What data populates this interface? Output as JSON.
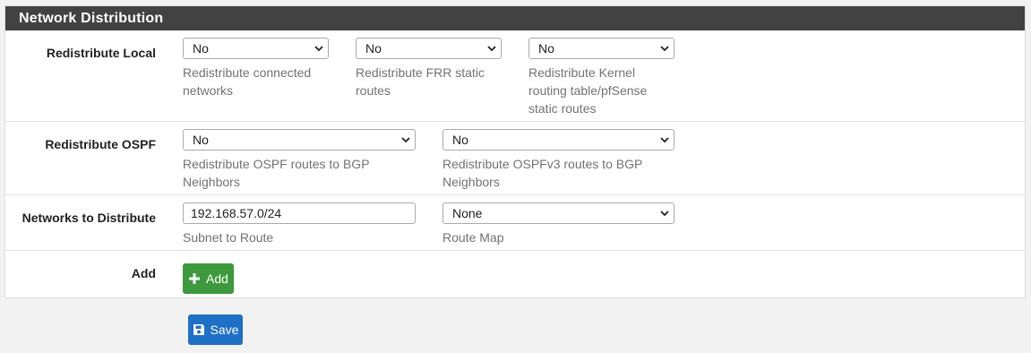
{
  "panel": {
    "title": "Network Distribution"
  },
  "redistribute_local": {
    "label": "Redistribute Local",
    "fields": [
      {
        "value": "No",
        "help": "Redistribute connected networks"
      },
      {
        "value": "No",
        "help": "Redistribute FRR static routes"
      },
      {
        "value": "No",
        "help": "Redistribute Kernel routing table/pfSense static routes"
      }
    ]
  },
  "redistribute_ospf": {
    "label": "Redistribute OSPF",
    "fields": [
      {
        "value": "No",
        "help": "Redistribute OSPF routes to BGP Neighbors"
      },
      {
        "value": "No",
        "help": "Redistribute OSPFv3 routes to BGP Neighbors"
      }
    ]
  },
  "networks": {
    "label": "Networks to Distribute",
    "subnet_value": "192.168.57.0/24",
    "subnet_help": "Subnet to Route",
    "route_map_value": "None",
    "route_map_help": "Route Map"
  },
  "add": {
    "label": "Add",
    "button_label": "Add"
  },
  "save": {
    "button_label": "Save"
  },
  "colors": {
    "header": "#424242",
    "add": "#3c9a3c",
    "save": "#1e6fc6"
  },
  "icons": {
    "select": "chevron-down-icon",
    "add": "plus-icon",
    "save": "save-icon"
  }
}
